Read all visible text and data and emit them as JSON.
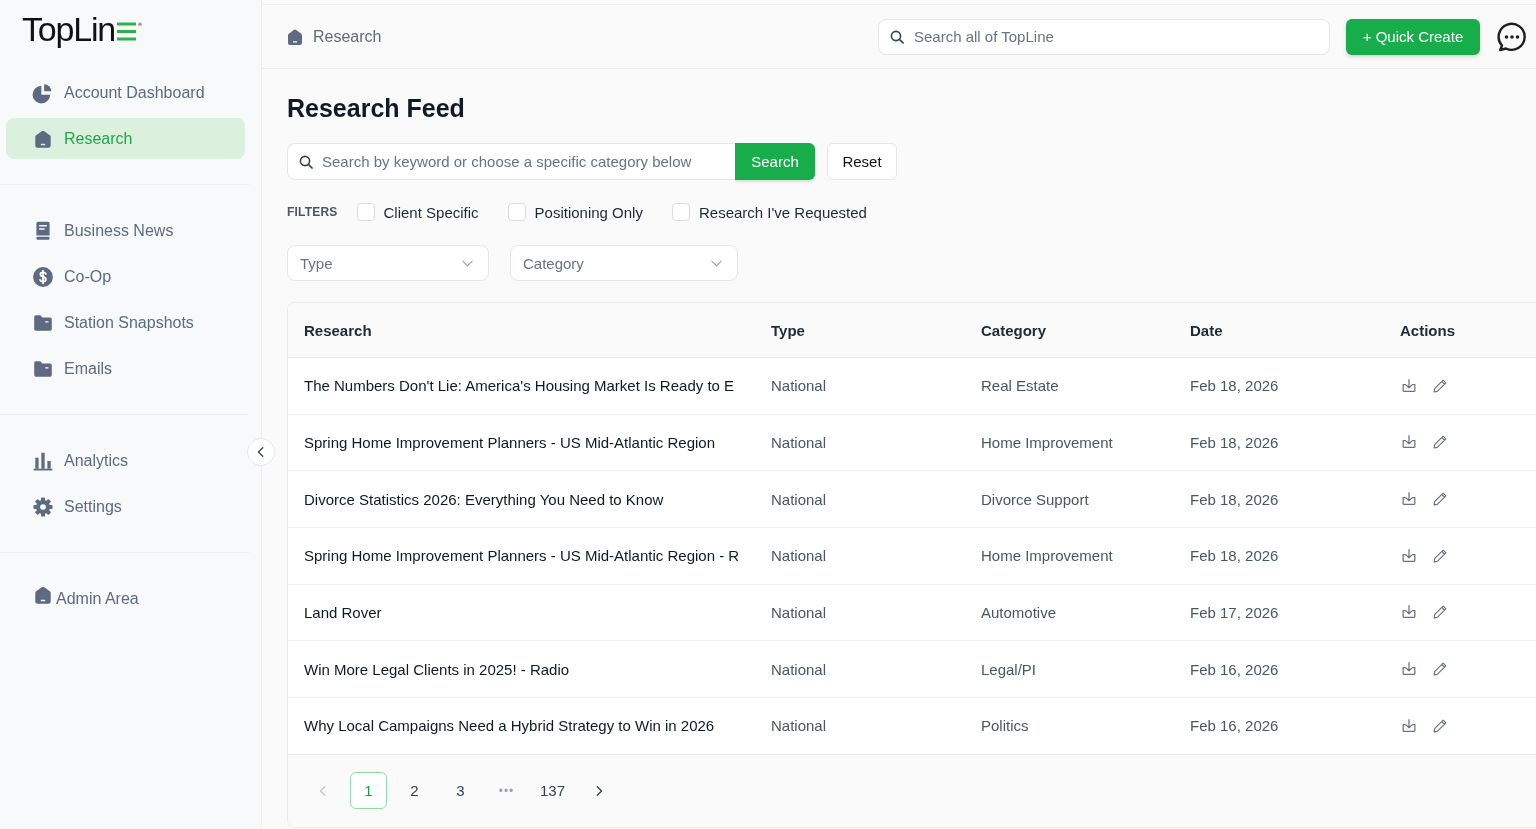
{
  "sidebar": {
    "logo": "TopLin",
    "nav_groups": [
      {
        "items": [
          {
            "label": "Account Dashboard",
            "selected": false
          },
          {
            "label": "Research",
            "selected": true
          }
        ]
      },
      {
        "items": [
          {
            "label": "Business News",
            "selected": false
          },
          {
            "label": "Co-Op",
            "selected": false
          },
          {
            "label": "Station Snapshots",
            "selected": false
          },
          {
            "label": "Emails",
            "selected": false
          }
        ]
      },
      {
        "items": [
          {
            "label": "Analytics",
            "selected": false
          },
          {
            "label": "Settings",
            "selected": false
          }
        ]
      },
      {
        "items": [
          {
            "label": "Admin Area",
            "selected": false
          }
        ]
      }
    ]
  },
  "header": {
    "breadcrumb": "Research",
    "search": {
      "placeholder": "Search all of TopLine"
    },
    "quick_create": "+ Quick Create"
  },
  "main": {
    "title": "Research Feed",
    "search": {
      "placeholder": "Search by keyword or choose a specific category below",
      "button": "Search",
      "reset": "Reset"
    },
    "filters": {
      "label": "FILTERS",
      "options": [
        {
          "label": "Client Specific",
          "checked": false
        },
        {
          "label": "Positioning Only",
          "checked": false
        },
        {
          "label": "Research I've Requested",
          "checked": false
        }
      ]
    },
    "dropdowns": [
      {
        "placeholder": "Type"
      },
      {
        "placeholder": "Category"
      }
    ],
    "table": {
      "columns": [
        "Research",
        "Type",
        "Category",
        "Date",
        "Actions"
      ],
      "rows": [
        {
          "research": "The Numbers Don't Lie: America's Housing Market Is Ready to E",
          "type": "National",
          "category": "Real Estate",
          "date": "Feb 18, 2026"
        },
        {
          "research": "Spring Home Improvement Planners - US Mid-Atlantic Region",
          "type": "National",
          "category": "Home Improvement",
          "date": "Feb 18, 2026"
        },
        {
          "research": "Divorce Statistics 2026: Everything You Need to Know",
          "type": "National",
          "category": "Divorce Support",
          "date": "Feb 18, 2026"
        },
        {
          "research": "Spring Home Improvement Planners - US Mid-Atlantic Region - R",
          "type": "National",
          "category": "Home Improvement",
          "date": "Feb 18, 2026"
        },
        {
          "research": "Land Rover",
          "type": "National",
          "category": "Automotive",
          "date": "Feb 17, 2026"
        },
        {
          "research": "Win More Legal Clients in 2025! - Radio",
          "type": "National",
          "category": "Legal/PI",
          "date": "Feb 16, 2026"
        },
        {
          "research": "Why Local Campaigns Need a Hybrid Strategy to Win in 2026",
          "type": "National",
          "category": "Politics",
          "date": "Feb 16, 2026"
        }
      ]
    },
    "pagination": {
      "prev": {
        "disabled": true
      },
      "pages": [
        {
          "kind": "page",
          "label": "1",
          "selected": true
        },
        {
          "kind": "page",
          "label": "2",
          "selected": false
        },
        {
          "kind": "page",
          "label": "3",
          "selected": false
        },
        {
          "kind": "ellipsis",
          "label": "•••",
          "selected": false
        },
        {
          "kind": "page",
          "label": "137",
          "selected": false
        }
      ],
      "next": {
        "disabled": false
      }
    }
  }
}
